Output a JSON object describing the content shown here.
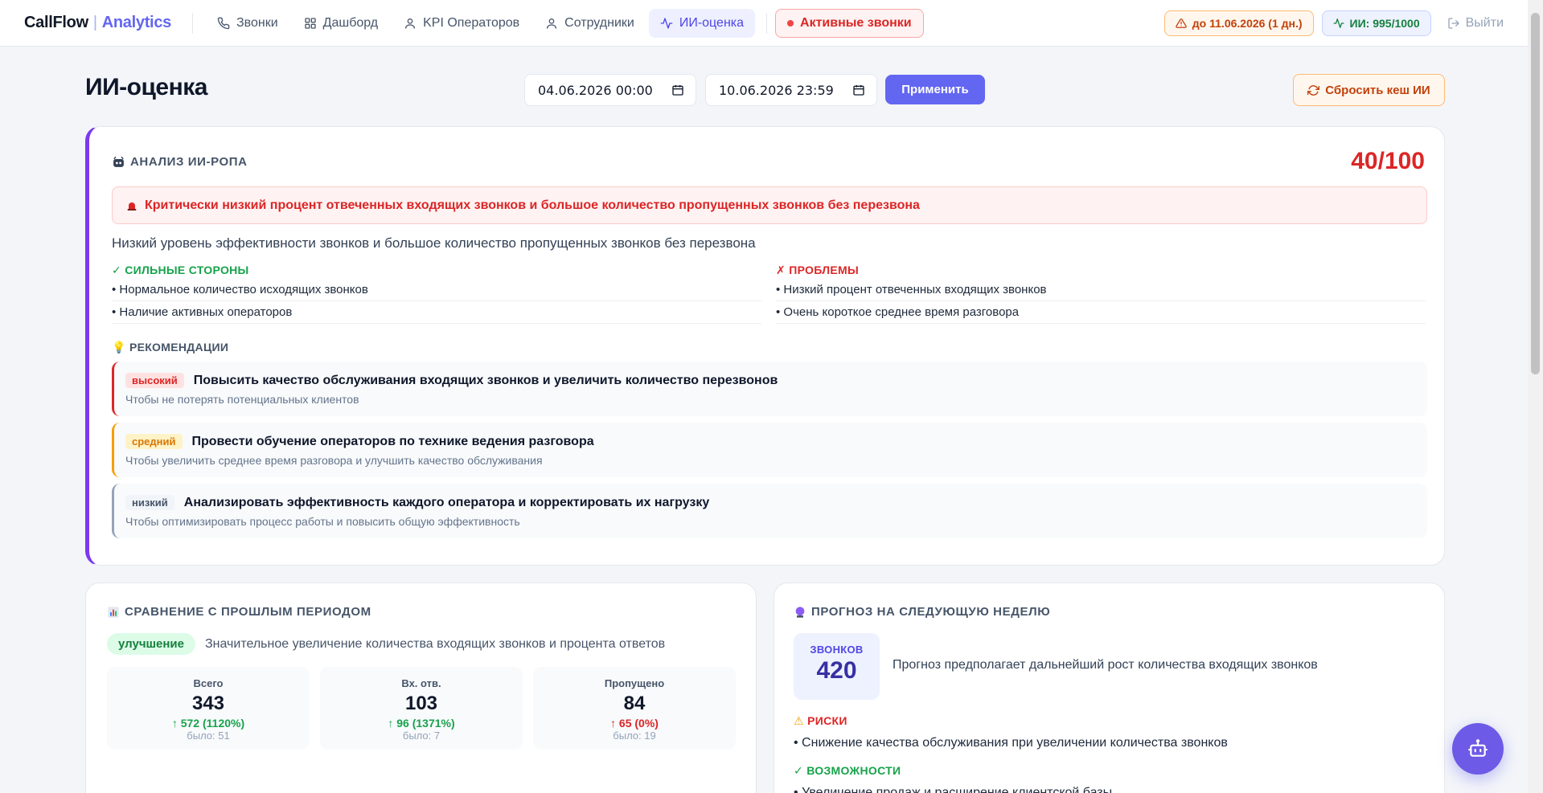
{
  "nav": {
    "brand_main": "CallFlow",
    "brand_sep": "|",
    "brand_accent": "Analytics",
    "items": [
      {
        "label": "Звонки",
        "icon": "phone-icon"
      },
      {
        "label": "Дашборд",
        "icon": "grid-icon"
      },
      {
        "label": "KPI Операторов",
        "icon": "user-icon"
      },
      {
        "label": "Сотрудники",
        "icon": "user-icon"
      },
      {
        "label": "ИИ-оценка",
        "icon": "activity-icon",
        "active": true
      }
    ],
    "live_label": "Активные звонки",
    "subscription_label": "до 11.06.2026 (1 дн.)",
    "ai_quota_label": "ИИ: 995/1000",
    "logout_label": "Выйти"
  },
  "header": {
    "title": "ИИ-оценка",
    "date_from": "04.06.2026 00:00",
    "date_to": "10.06.2026 23:59",
    "apply_label": "Применить",
    "reset_label": "Сбросить кеш ИИ"
  },
  "analysis": {
    "heading": "АНАЛИЗ ИИ-РОПА",
    "score": "40/100",
    "alert": "Критически низкий процент отвеченных входящих звонков и большое количество пропущенных звонков без перезвона",
    "summary": "Низкий уровень эффективности звонков и большое количество пропущенных звонков без перезвона",
    "strengths_heading": "СИЛЬНЫЕ СТОРОНЫ",
    "strengths": [
      "• Нормальное количество исходящих звонков",
      "• Наличие активных операторов"
    ],
    "problems_heading": "ПРОБЛЕМЫ",
    "problems": [
      "• Низкий процент отвеченных входящих звонков",
      "• Очень короткое среднее время разговора"
    ],
    "recommendations_heading": "РЕКОМЕНДАЦИИ",
    "recommendations": [
      {
        "priority": "высокий",
        "title": "Повысить качество обслуживания входящих звонков и увеличить количество перезвонов",
        "reason": "Чтобы не потерять потенциальных клиентов"
      },
      {
        "priority": "средний",
        "title": "Провести обучение операторов по технике ведения разговора",
        "reason": "Чтобы увеличить среднее время разговора и улучшить качество обслуживания"
      },
      {
        "priority": "низкий",
        "title": "Анализировать эффективность каждого оператора и корректировать их нагрузку",
        "reason": "Чтобы оптимизировать процесс работы и повысить общую эффективность"
      }
    ]
  },
  "comparison": {
    "heading": "СРАВНЕНИЕ С ПРОШЛЫМ ПЕРИОДОМ",
    "status": "улучшение",
    "description": "Значительное увеличение количества входящих звонков и процента ответов",
    "stats": [
      {
        "label": "Всего",
        "value": "343",
        "delta": "572 (1120%)",
        "direction": "up",
        "was": "было: 51"
      },
      {
        "label": "Вх. отв.",
        "value": "103",
        "delta": "96 (1371%)",
        "direction": "up",
        "was": "было: 7"
      },
      {
        "label": "Пропущено",
        "value": "84",
        "delta": "65 (0%)",
        "direction": "down",
        "was": "было: 19"
      }
    ]
  },
  "forecast": {
    "heading": "ПРОГНОЗ НА СЛЕДУЮЩУЮ НЕДЕЛЮ",
    "calls_label": "ЗВОНКОВ",
    "calls_value": "420",
    "description": "Прогноз предполагает дальнейший рост количества входящих звонков",
    "risks_heading": "РИСКИ",
    "risks": [
      "• Снижение качества обслуживания при увеличении количества звонков"
    ],
    "opportunities_heading": "ВОЗМОЖНОСТИ",
    "opportunities": [
      "• Увеличение продаж и расширение клиентской базы"
    ]
  },
  "colors": {
    "accent": "#6366f1",
    "danger": "#dc2626",
    "success": "#16a34a",
    "warning": "#f59e0b"
  }
}
